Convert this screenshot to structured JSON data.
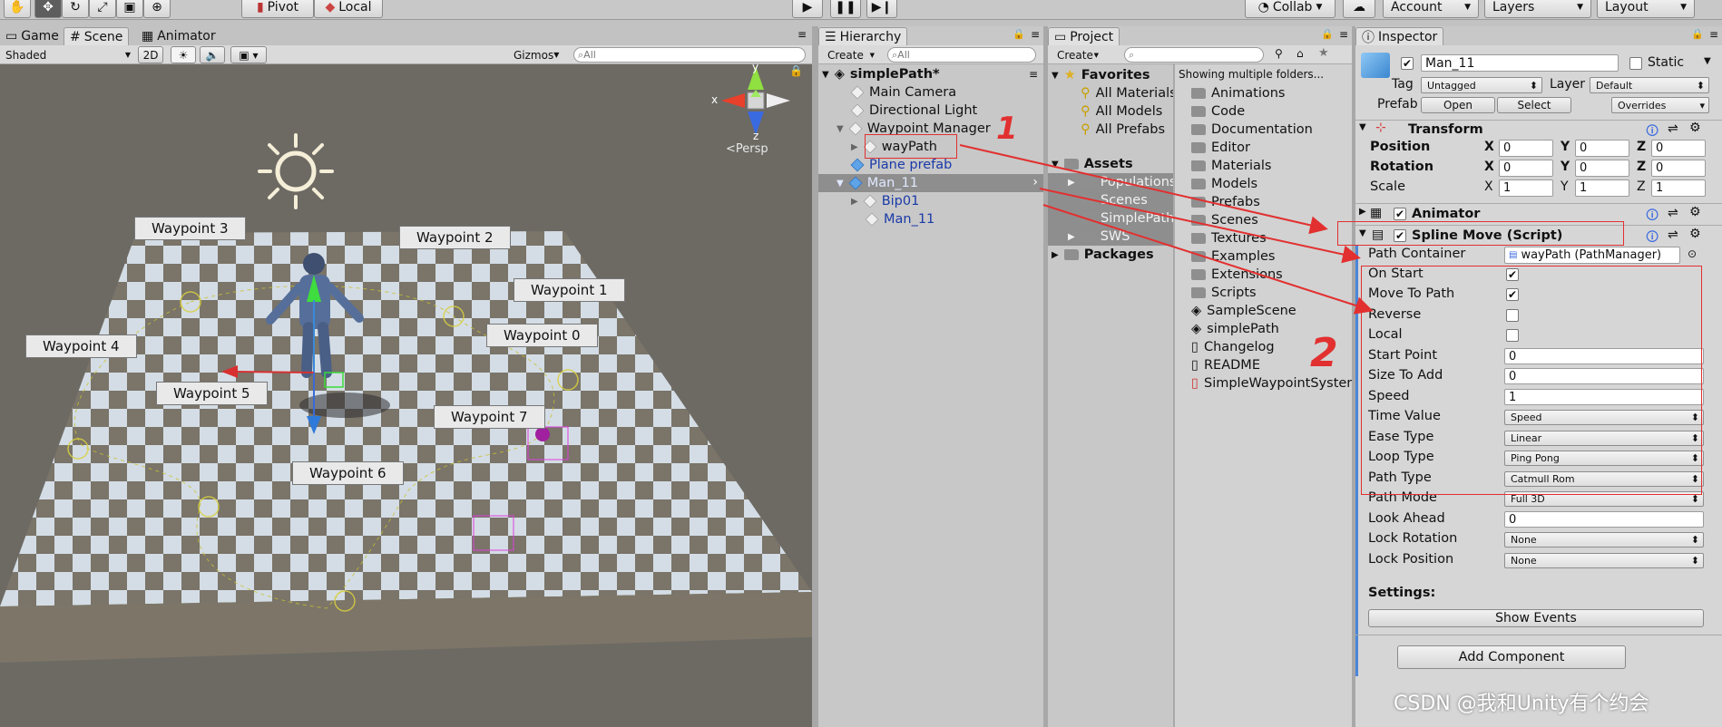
{
  "toolbar": {
    "pivot": "Pivot",
    "local": "Local",
    "collab": "Collab",
    "account": "Account",
    "layers": "Layers",
    "layout": "Layout"
  },
  "scene_tabs": [
    "Game",
    "Scene",
    "Animator"
  ],
  "scene_toolbar": {
    "shading": "Shaded",
    "mode_2d": "2D",
    "gizmos": "Gizmos",
    "search_placeholder": "All"
  },
  "gizmo": {
    "x": "x",
    "y": "y",
    "z": "z",
    "persp": "Persp"
  },
  "waypoints": [
    "Waypoint 3",
    "Waypoint 2",
    "Waypoint 1",
    "Waypoint 0",
    "Waypoint 4",
    "Waypoint 5",
    "Waypoint 7",
    "Waypoint 6"
  ],
  "hierarchy": {
    "tab": "Hierarchy",
    "create": "Create",
    "search_placeholder": "All",
    "scene": "simplePath*",
    "items": [
      "Main Camera",
      "Directional Light",
      "Waypoint Manager",
      "wayPath",
      "Plane prefab",
      "Man_11",
      "Bip01",
      "Man_11"
    ]
  },
  "project": {
    "tab": "Project",
    "create": "Create",
    "favorites": "Favorites",
    "favorite_items": [
      "All Materials",
      "All Models",
      "All Prefabs"
    ],
    "assets": "Assets",
    "asset_folders": [
      "Populations",
      "Scenes",
      "SimplePath",
      "SWS"
    ],
    "packages": "Packages",
    "showing": "Showing multiple folders...",
    "files": [
      "Animations",
      "Code",
      "Documentation",
      "Editor",
      "Materials",
      "Models",
      "Prefabs",
      "Scenes",
      "Textures",
      "Examples",
      "Extensions",
      "Scripts",
      "SampleScene",
      "simplePath",
      "Changelog",
      "README",
      "SimpleWaypointSystem"
    ]
  },
  "inspector": {
    "tab": "Inspector",
    "name": "Man_11",
    "static": "Static",
    "tag_label": "Tag",
    "tag": "Untagged",
    "layer_label": "Layer",
    "layer": "Default",
    "prefab_label": "Prefab",
    "open": "Open",
    "select": "Select",
    "overrides": "Overrides",
    "transform": {
      "title": "Transform",
      "position": "Position",
      "rotation": "Rotation",
      "scale": "Scale",
      "pos": [
        "0",
        "0",
        "0"
      ],
      "rot": [
        "0",
        "0",
        "0"
      ],
      "scl": [
        "1",
        "1",
        "1"
      ]
    },
    "animator": "Animator",
    "spline": {
      "title": "Spline Move (Script)",
      "path_container_label": "Path Container",
      "path_container": "wayPath (PathManager)",
      "on_start": "On Start",
      "move_to_path": "Move To Path",
      "reverse": "Reverse",
      "local": "Local",
      "start_point": "Start Point",
      "start_point_val": "0",
      "size_to_add": "Size To Add",
      "size_to_add_val": "0",
      "speed": "Speed",
      "speed_val": "1",
      "time_value": "Time Value",
      "time_value_val": "Speed",
      "ease_type": "Ease Type",
      "ease_type_val": "Linear",
      "loop_type": "Loop Type",
      "loop_type_val": "Ping Pong",
      "path_type": "Path Type",
      "path_type_val": "Catmull Rom",
      "path_mode": "Path Mode",
      "path_mode_val": "Full 3D",
      "look_ahead": "Look Ahead",
      "look_ahead_val": "0",
      "lock_rotation": "Lock Rotation",
      "lock_rotation_val": "None",
      "lock_position": "Lock Position",
      "lock_position_val": "None",
      "settings": "Settings:",
      "show_events": "Show Events"
    },
    "add_component": "Add Component"
  },
  "annotations": {
    "one": "1",
    "two": "2"
  },
  "watermark": "CSDN @我和Unity有个约会"
}
